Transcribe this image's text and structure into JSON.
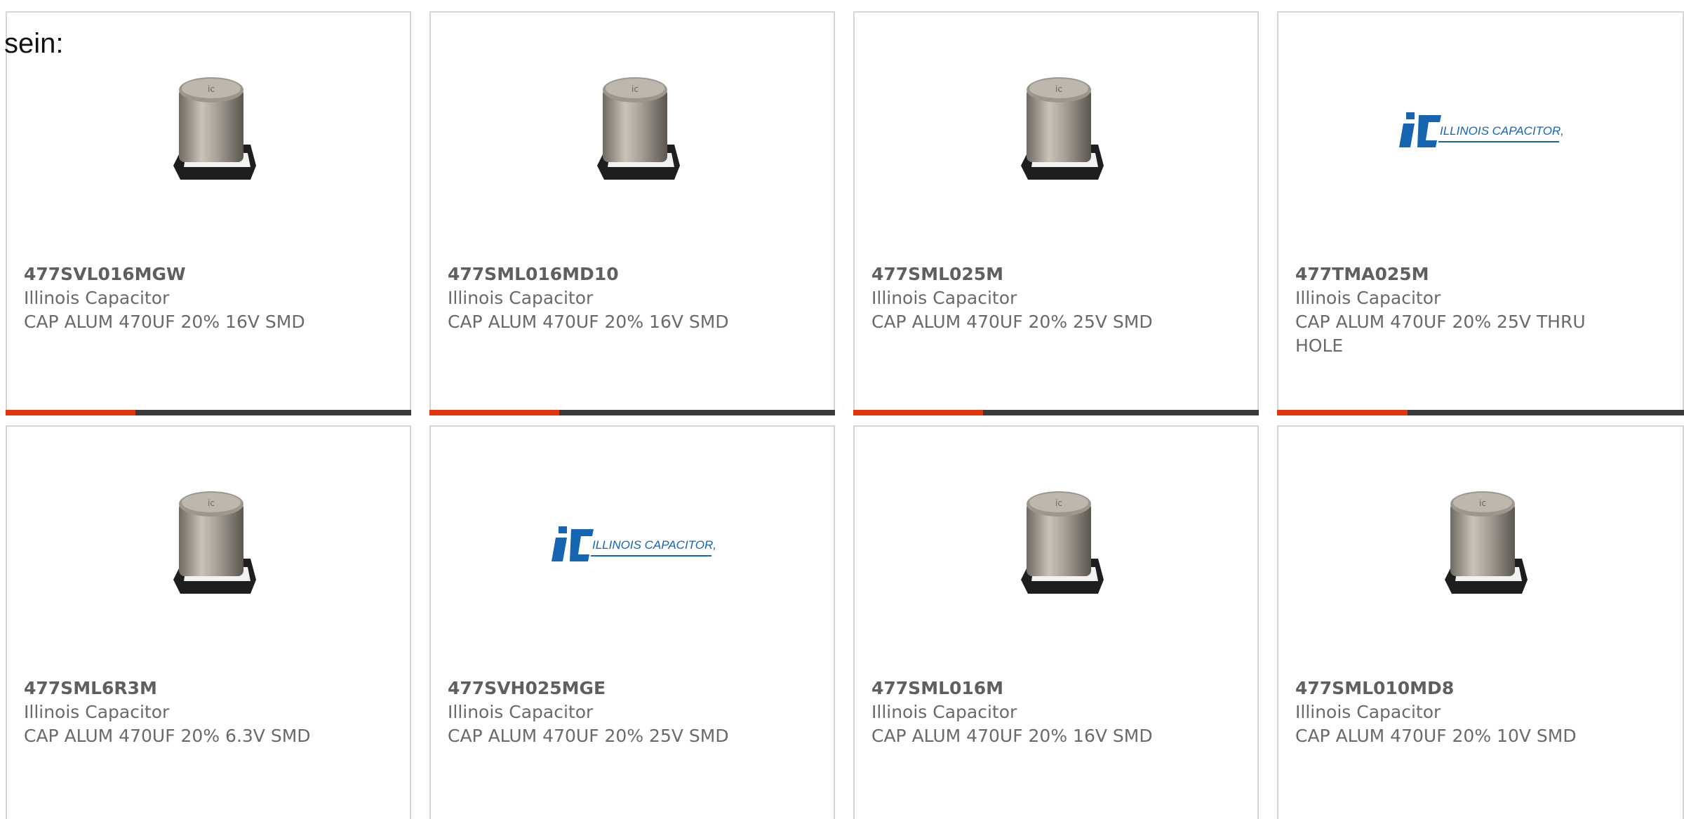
{
  "intro": {
    "text": "sein:"
  },
  "cards": [
    {
      "part": "477SVL016MGW",
      "mfr": "Illinois Capacitor",
      "desc": "CAP ALUM 470UF 20% 16V SMD",
      "image": "capacitor-icon"
    },
    {
      "part": "477SML016MD10",
      "mfr": "Illinois Capacitor",
      "desc": "CAP ALUM 470UF 20% 16V SMD",
      "image": "capacitor-icon"
    },
    {
      "part": "477SML025M",
      "mfr": "Illinois Capacitor",
      "desc": "CAP ALUM 470UF 20% 25V SMD",
      "image": "capacitor-icon"
    },
    {
      "part": "477TMA025M",
      "mfr": "Illinois Capacitor",
      "desc": "CAP ALUM 470UF 20% 25V THRU HOLE",
      "image": "illinois-capacitor-logo",
      "logo_text": "ILLINOIS CAPACITOR, INC."
    },
    {
      "part": "477SML6R3M",
      "mfr": "Illinois Capacitor",
      "desc": "CAP ALUM 470UF 20% 6.3V SMD",
      "image": "capacitor-icon"
    },
    {
      "part": "477SVH025MGE",
      "mfr": "Illinois Capacitor",
      "desc": "CAP ALUM 470UF 20% 25V SMD",
      "image": "illinois-capacitor-logo",
      "logo_text": "ILLINOIS CAPACITOR, INC."
    },
    {
      "part": "477SML016M",
      "mfr": "Illinois Capacitor",
      "desc": "CAP ALUM 470UF 20% 16V SMD",
      "image": "capacitor-icon"
    },
    {
      "part": "477SML010MD8",
      "mfr": "Illinois Capacitor",
      "desc": "CAP ALUM 470UF 20% 10V SMD",
      "image": "capacitor-icon"
    }
  ],
  "colors": {
    "accent": "#e3360f",
    "bar_dark": "#3a3a3a",
    "logo_blue": "#1565b0"
  }
}
